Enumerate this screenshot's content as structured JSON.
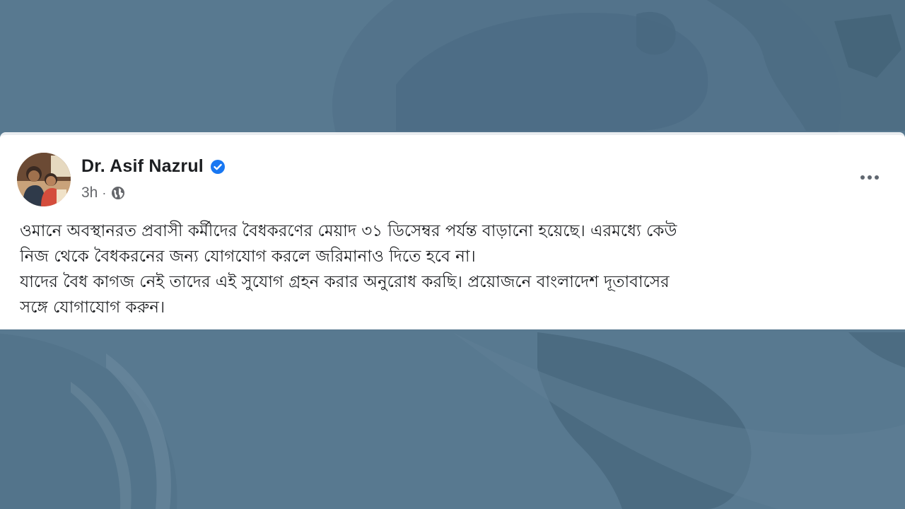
{
  "post": {
    "author_name": "Dr. Asif Nazrul",
    "timestamp": "3h",
    "separator": "·",
    "avatar_icon": "profile-photo",
    "verified_icon": "verified-badge-icon",
    "privacy_icon": "globe-icon",
    "more_icon": "more-options-icon",
    "text_lines": [
      "ওমানে অবস্থানরত প্রবাসী কর্মীদের বৈধকরণের মেয়াদ ৩১ ডিসেম্বর পর্যন্ত বাড়ানো হয়েছে। এরমধ্যে কেউ",
      "নিজ থেকে বৈধকরনের জন্য যোগযোগ করলে জরিমানাও দিতে হবে না।",
      "যাদের বৈধ কাগজ নেই তাদের এই সুযোগ গ্রহন করার অনুরোধ করছি। প্রয়োজনে বাংলাদেশ দূতাবাসের",
      "সঙ্গে যোগাযোগ করুন।"
    ]
  },
  "colors": {
    "background": "#587990",
    "card": "#ffffff",
    "verified": "#1877f2",
    "text": "#1c1e21",
    "meta": "#65676b"
  }
}
